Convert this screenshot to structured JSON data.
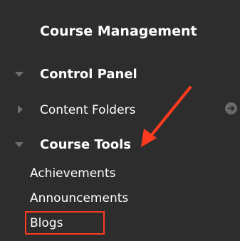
{
  "sidebar": {
    "heading": "Course Management",
    "sections": [
      {
        "label": "Control Panel"
      },
      {
        "label": "Content Folders"
      },
      {
        "label": "Course Tools"
      }
    ],
    "items": [
      {
        "label": "Achievements"
      },
      {
        "label": "Announcements"
      },
      {
        "label": "Blogs"
      }
    ]
  },
  "icons": {
    "expanded": "triangle-down-icon",
    "collapsed": "triangle-right-icon",
    "collapse_panel": "arrow-right-circle-icon"
  },
  "colors": {
    "background": "#2d2d2d",
    "text": "#ffffff",
    "annotation": "#ff3b1f",
    "icon": "#6f6f6f"
  }
}
